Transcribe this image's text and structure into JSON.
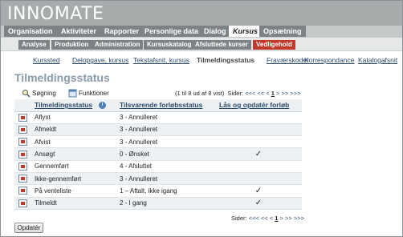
{
  "app": {
    "logo": "INNOMATE"
  },
  "main_nav": {
    "tabs": [
      {
        "label": "Organisation"
      },
      {
        "label": "Aktiviteter"
      },
      {
        "label": "Rapporter"
      },
      {
        "label": "Personlige data"
      },
      {
        "label": "Dialog"
      },
      {
        "label": "Kursus"
      },
      {
        "label": "Opsætning"
      }
    ]
  },
  "sub_nav": {
    "tabs": [
      {
        "label": "Analyse"
      },
      {
        "label": "Produktion"
      },
      {
        "label": "Administration"
      },
      {
        "label": "Kursuskatalog"
      },
      {
        "label": "Afsluttede kurser"
      },
      {
        "label": "Vedligehold"
      }
    ]
  },
  "section_nav": {
    "items": [
      {
        "label": "Kurssted"
      },
      {
        "label": "Delopgave, kursus"
      },
      {
        "label": "Tekstafsnit, kursus"
      },
      {
        "label": "Tilmeldingsstatus"
      },
      {
        "label": "Fraværskoder"
      },
      {
        "label": "Korrespondance"
      },
      {
        "label": "Katalogafsnit"
      }
    ]
  },
  "page": {
    "title": "Tilmeldingsstatus"
  },
  "toolbar": {
    "search_label": "Søgning",
    "functions_label": "Funktioner"
  },
  "pager": {
    "count_text": "(1 til 8 ud af 8 vist)",
    "pages_label": "Sider:",
    "first": "<<<",
    "prev": "<<",
    "lt": "<",
    "current": "1",
    "gt": ">",
    "next": ">>",
    "last": ">>>"
  },
  "table": {
    "headers": {
      "status": "Tilmeldingsstatus",
      "info": "i",
      "course_status": "Tilsvarende forløbsstatus",
      "lock": "Lås og opdatér forløb"
    },
    "rows": [
      {
        "status": "Aflyst",
        "course_status": "3 - Annulleret",
        "lock": ""
      },
      {
        "status": "Afmeldt",
        "course_status": "3 - Annulleret",
        "lock": ""
      },
      {
        "status": "Afvist",
        "course_status": "3 - Annulleret",
        "lock": ""
      },
      {
        "status": "Ansøgt",
        "course_status": "0 - Ønsket",
        "lock": "✓"
      },
      {
        "status": "Gennemført",
        "course_status": "4 - Afsluttet",
        "lock": ""
      },
      {
        "status": "Ikke-gennemført",
        "course_status": "3 - Annulleret",
        "lock": ""
      },
      {
        "status": "På venteliste",
        "course_status": "1 – Aftalt, ikke igang",
        "lock": "✓"
      },
      {
        "status": "Tilmeldt",
        "course_status": "2 - I gang",
        "lock": "✓"
      }
    ]
  },
  "actions": {
    "update_label": "Opdatér"
  },
  "colors": {
    "header_bg": "#a6acac",
    "nav_tab": "#7d8385",
    "active_subtab": "#c0392b",
    "link": "#2a4a6a"
  }
}
